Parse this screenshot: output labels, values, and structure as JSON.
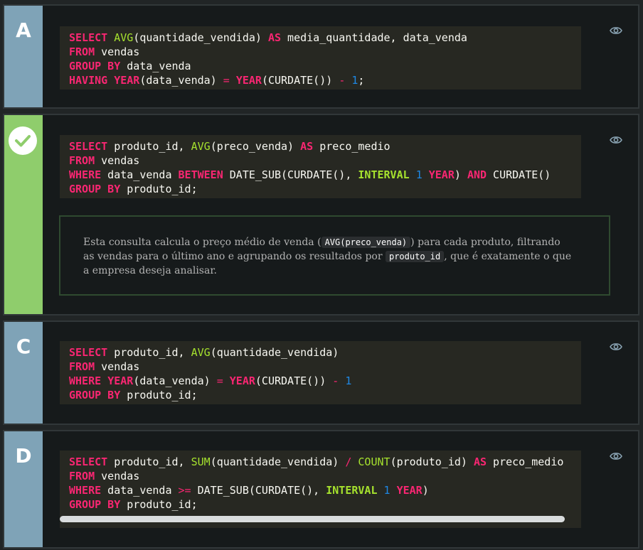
{
  "options": [
    {
      "letter": "A",
      "correct": false,
      "code_lines": [
        [
          [
            "kw",
            "SELECT"
          ],
          [
            "t",
            " "
          ],
          [
            "fn",
            "AVG"
          ],
          [
            "t",
            "(quantidade_vendida) "
          ],
          [
            "kw",
            "AS"
          ],
          [
            "t",
            " media_quantidade, data_venda"
          ]
        ],
        [
          [
            "kw",
            "FROM"
          ],
          [
            "t",
            " vendas"
          ]
        ],
        [
          [
            "kw",
            "GROUP BY"
          ],
          [
            "t",
            " data_venda"
          ]
        ],
        [
          [
            "kw",
            "HAVING"
          ],
          [
            "t",
            " "
          ],
          [
            "kw",
            "YEAR"
          ],
          [
            "t",
            "(data_venda) "
          ],
          [
            "op",
            "="
          ],
          [
            "t",
            " "
          ],
          [
            "kw",
            "YEAR"
          ],
          [
            "t",
            "(CURDATE()) "
          ],
          [
            "op",
            "-"
          ],
          [
            "t",
            " "
          ],
          [
            "nm",
            "1"
          ],
          [
            "t",
            ";"
          ]
        ]
      ]
    },
    {
      "letter": "B",
      "correct": true,
      "code_lines": [
        [
          [
            "kw",
            "SELECT"
          ],
          [
            "t",
            " produto_id, "
          ],
          [
            "fn",
            "AVG"
          ],
          [
            "t",
            "(preco_venda) "
          ],
          [
            "kw",
            "AS"
          ],
          [
            "t",
            " preco_medio"
          ]
        ],
        [
          [
            "kw",
            "FROM"
          ],
          [
            "t",
            " vendas"
          ]
        ],
        [
          [
            "kw",
            "WHERE"
          ],
          [
            "t",
            " data_venda "
          ],
          [
            "kw",
            "BETWEEN"
          ],
          [
            "t",
            " DATE_SUB(CURDATE(), "
          ],
          [
            "iv",
            "INTERVAL"
          ],
          [
            "t",
            " "
          ],
          [
            "nm",
            "1"
          ],
          [
            "t",
            " "
          ],
          [
            "kw",
            "YEAR"
          ],
          [
            "t",
            ") "
          ],
          [
            "kw",
            "AND"
          ],
          [
            "t",
            " CURDATE()"
          ]
        ],
        [
          [
            "kw",
            "GROUP BY"
          ],
          [
            "t",
            " produto_id;"
          ]
        ]
      ],
      "explanation": {
        "part1": "Esta consulta calcula o preço médio de venda (",
        "code1": "AVG(preco_venda)",
        "part2": ") para cada produto, filtrando as vendas para o último ano e agrupando os resultados por ",
        "code2": "produto_id",
        "part3": ", que é exatamente o que a empresa deseja analisar."
      }
    },
    {
      "letter": "C",
      "correct": false,
      "code_lines": [
        [
          [
            "kw",
            "SELECT"
          ],
          [
            "t",
            " produto_id, "
          ],
          [
            "fn",
            "AVG"
          ],
          [
            "t",
            "(quantidade_vendida)"
          ]
        ],
        [
          [
            "kw",
            "FROM"
          ],
          [
            "t",
            " vendas"
          ]
        ],
        [
          [
            "kw",
            "WHERE"
          ],
          [
            "t",
            " "
          ],
          [
            "kw",
            "YEAR"
          ],
          [
            "t",
            "(data_venda) "
          ],
          [
            "op",
            "="
          ],
          [
            "t",
            " "
          ],
          [
            "kw",
            "YEAR"
          ],
          [
            "t",
            "(CURDATE()) "
          ],
          [
            "op",
            "-"
          ],
          [
            "t",
            " "
          ],
          [
            "nm",
            "1"
          ]
        ],
        [
          [
            "kw",
            "GROUP BY"
          ],
          [
            "t",
            " produto_id;"
          ]
        ]
      ]
    },
    {
      "letter": "D",
      "correct": false,
      "code_lines": [
        [
          [
            "kw",
            "SELECT"
          ],
          [
            "t",
            " produto_id, "
          ],
          [
            "fn",
            "SUM"
          ],
          [
            "t",
            "(quantidade_vendida) "
          ],
          [
            "op",
            "/"
          ],
          [
            "t",
            " "
          ],
          [
            "fn",
            "COUNT"
          ],
          [
            "t",
            "(produto_id) "
          ],
          [
            "kw",
            "AS"
          ],
          [
            "t",
            " preco_medio"
          ]
        ],
        [
          [
            "kw",
            "FROM"
          ],
          [
            "t",
            " vendas"
          ]
        ],
        [
          [
            "kw",
            "WHERE"
          ],
          [
            "t",
            " data_venda "
          ],
          [
            "op",
            ">="
          ],
          [
            "t",
            " DATE_SUB(CURDATE(), "
          ],
          [
            "iv",
            "INTERVAL"
          ],
          [
            "t",
            " "
          ],
          [
            "nm",
            "1"
          ],
          [
            "t",
            " "
          ],
          [
            "kw",
            "YEAR"
          ],
          [
            "t",
            ")"
          ]
        ],
        [
          [
            "kw",
            "GROUP BY"
          ],
          [
            "t",
            " produto_id;"
          ]
        ]
      ]
    }
  ],
  "icons": {
    "toggle": "eye-icon",
    "correct": "check-icon"
  },
  "colors": {
    "badge": "#7fa3b7",
    "badge_correct": "#8fcd6c",
    "code_bg": "#272822",
    "keyword": "#f92672",
    "function": "#a6e22e",
    "number": "#1e88e5"
  }
}
